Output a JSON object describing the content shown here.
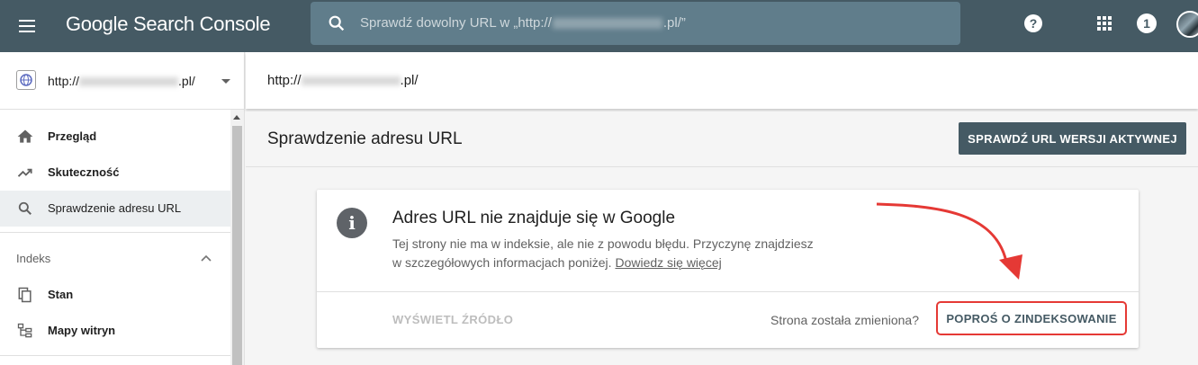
{
  "app": {
    "brand": "Google Search Console",
    "search_placeholder_prefix": "Sprawdź dowolny URL w „http://",
    "search_placeholder_suffix": ".pl/”",
    "notification_count": "1"
  },
  "sidebar": {
    "property_prefix": "http://",
    "property_suffix": ".pl/",
    "items": [
      {
        "label": "Przegląd",
        "icon": "home-icon"
      },
      {
        "label": "Skuteczność",
        "icon": "trending-up-icon"
      },
      {
        "label": "Sprawdzenie adresu URL",
        "icon": "search-icon",
        "active": true
      }
    ],
    "section_label": "Indeks",
    "index_items": [
      {
        "label": "Stan",
        "icon": "copy-icon"
      },
      {
        "label": "Mapy witryn",
        "icon": "sitemap-icon"
      }
    ]
  },
  "main": {
    "url_prefix": "http://",
    "url_suffix": ".pl/",
    "page_title": "Sprawdzenie adresu URL",
    "live_test_button": "SPRAWDŹ URL WERSJI AKTYWNEJ",
    "card": {
      "title": "Adres URL nie znajduje się w Google",
      "desc_line1": "Tej strony nie ma w indeksie, ale nie z powodu błędu. Przyczynę znajdziesz",
      "desc_line2": "w szczegółowych informacjach poniżej.",
      "learn_more": "Dowiedz się więcej",
      "view_source": "WYŚWIETL ŹRÓDŁO",
      "changed_question": "Strona została zmieniona?",
      "request_indexing": "POPROŚ O ZINDEKSOWANIE"
    }
  },
  "colors": {
    "topbar": "#455a64",
    "annotation": "#e53935"
  }
}
